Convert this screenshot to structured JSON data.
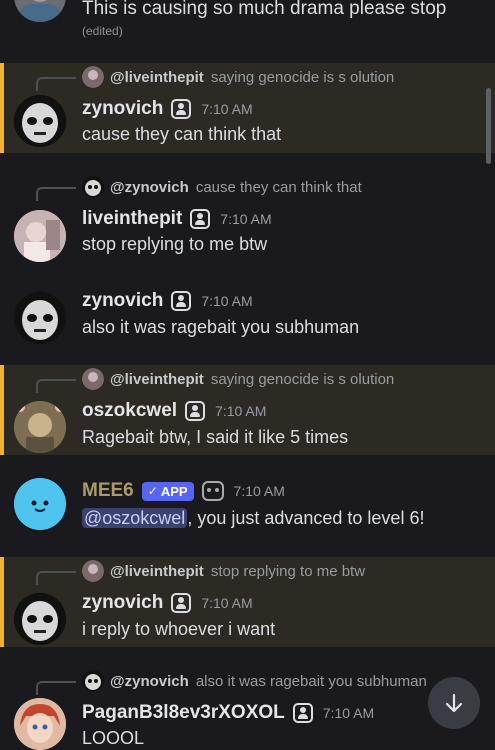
{
  "messages": [
    {
      "top_text": "This is causing so much drama please stop",
      "edited": "(edited)"
    },
    {
      "reply_name": "@liveinthepit",
      "reply_text": "saying genocide is s olution",
      "username": "zynovich",
      "time": "7:10 AM",
      "text": "cause they can think that"
    },
    {
      "reply_name": "@zynovich",
      "reply_text": "cause they can think that",
      "username": "liveinthepit",
      "time": "7:10 AM",
      "text": "stop replying to me btw"
    },
    {
      "username": "zynovich",
      "time": "7:10 AM",
      "text": "also it was ragebait you subhuman"
    },
    {
      "reply_name": "@liveinthepit",
      "reply_text": "saying genocide is s olution",
      "username": "oszokcwel",
      "time": "7:10 AM",
      "text": "Ragebait btw, I said it like 5 times"
    },
    {
      "username": "MEE6",
      "app_tag": "APP",
      "time": "7:10 AM",
      "mention": "@oszokcwel",
      "text": ", you just advanced to level 6!"
    },
    {
      "reply_name": "@liveinthepit",
      "reply_text": "stop replying to me btw",
      "username": "zynovich",
      "time": "7:10 AM",
      "text": "i reply to whoever i want"
    },
    {
      "reply_name": "@zynovich",
      "reply_text": "also it was ragebait you subhuman",
      "username": "PaganB3l8ev3rXOXOL",
      "time": "7:10 AM",
      "text": "LOOOL"
    }
  ],
  "colors": {
    "mention_bar": "#f0b232",
    "app_tag": "#5865f2",
    "background": "#1a1a1e"
  },
  "icons": {
    "scroll": "arrow-down-icon",
    "badge": "user-badge-icon",
    "bot": "robot-icon"
  }
}
